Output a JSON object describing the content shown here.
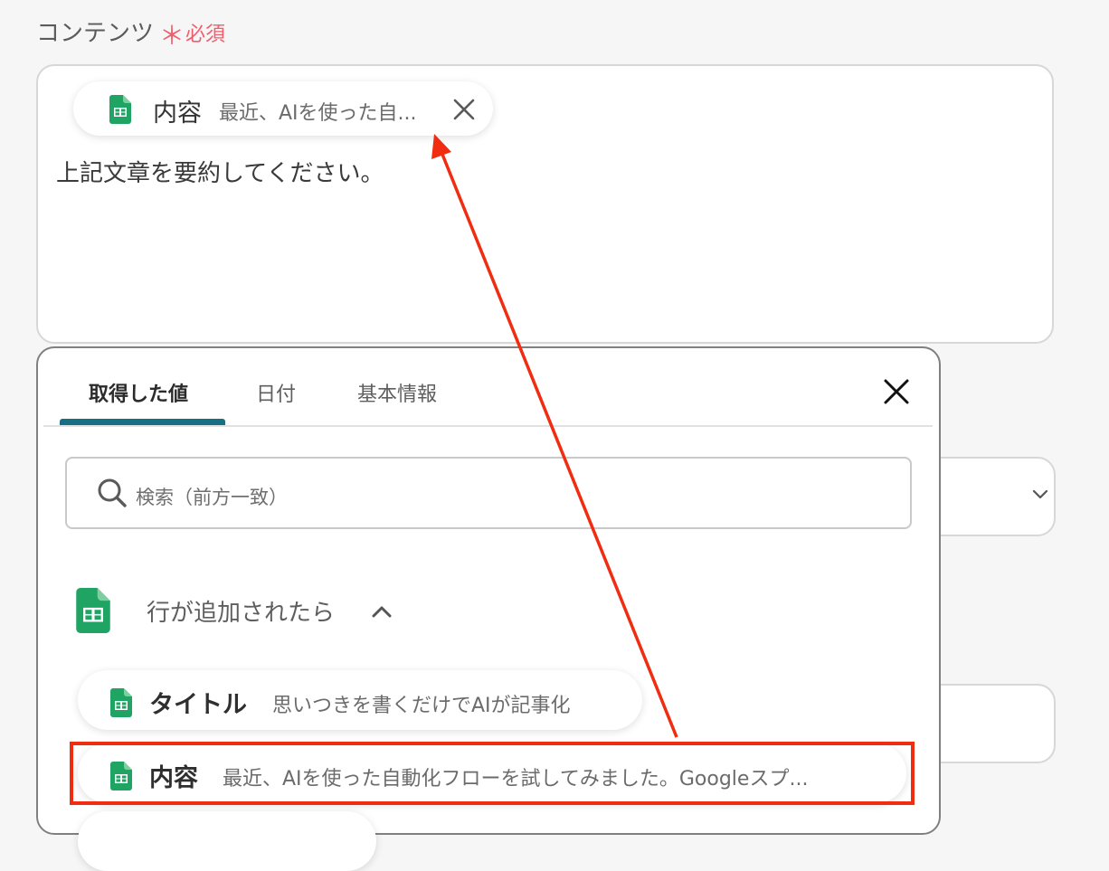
{
  "field": {
    "label": "コンテンツ",
    "required_star": "＊",
    "required_label": "必須",
    "chip": {
      "name": "内容",
      "value": "最近、AIを使った自...",
      "icon": "google-sheets-icon",
      "close_icon": "close-icon"
    },
    "text": "上記文章を要約してください。"
  },
  "popup": {
    "tabs": [
      {
        "label": "取得した値",
        "active": true
      },
      {
        "label": "日付",
        "active": false
      },
      {
        "label": "基本情報",
        "active": false
      }
    ],
    "close_icon": "close-icon",
    "search": {
      "placeholder": "検索（前方一致）",
      "icon": "search-icon"
    },
    "section": {
      "title": "行が追加されたら",
      "icon": "google-sheets-icon",
      "toggle_icon": "chevron-up-icon",
      "items": [
        {
          "name": "タイトル",
          "value": "思いつきを書くだけでAIが記事化"
        },
        {
          "name": "内容",
          "value": "最近、AIを使った自動化フローを試してみました。Googleスプ..."
        }
      ]
    }
  },
  "annotation": {
    "highlight_color": "#f02d10",
    "arrow_color": "#f02d10"
  },
  "colors": {
    "accent": "#176f83",
    "required": "#f25c6c",
    "sheets_green": "#1fa463"
  }
}
